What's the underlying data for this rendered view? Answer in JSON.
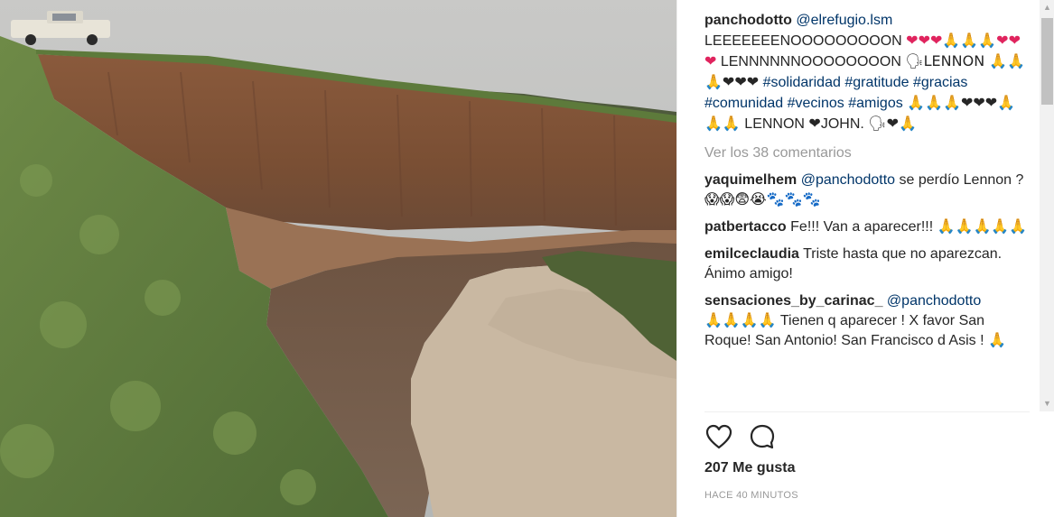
{
  "post": {
    "author": "panchodotto",
    "mention": "@elrefugio.lsm",
    "caption_parts": [
      "LEEEEEEENOOOOOOOOON",
      "❤❤❤🙏🙏🙏❤❤❤",
      "LENNNNNNOOOOOOOON",
      "🗣LENNON 🙏🙏🙏❤❤❤",
      "#solidaridad",
      "#gratitude",
      "#gracias",
      "#comunidad",
      "#vecinos",
      "#amigos",
      "🙏🙏🙏❤❤❤🙏🙏🙏",
      "LENNON ❤JOHN. 🗣❤🙏"
    ],
    "view_all": "Ver los 38 comentarios",
    "likes": "207 Me gusta",
    "time": "HACE 40 MINUTOS"
  },
  "comments": [
    {
      "user": "yaquimelhem",
      "mention": "@panchodotto",
      "text": " se perdío Lennon ? 😱😱😨😭🐾🐾🐾"
    },
    {
      "user": "patbertacco",
      "mention": "",
      "text": "Fe!!! Van a aparecer!!! 🙏🙏🙏🙏🙏"
    },
    {
      "user": "emilceclaudia",
      "mention": "",
      "text": "Triste hasta que no aparezcan. Ánimo amigo!"
    },
    {
      "user": "sensaciones_by_carinac_",
      "mention": "@panchodotto",
      "text": "🙏🙏🙏🙏 Tienen q aparecer ! X favor San Roque! San Antonio! San Francisco d Asis ! 🙏"
    }
  ],
  "icons": {
    "like": "heart-outline-icon",
    "comment": "speech-bubble-icon"
  },
  "colors": {
    "link": "#003569",
    "text": "#262626",
    "muted": "#999999"
  }
}
